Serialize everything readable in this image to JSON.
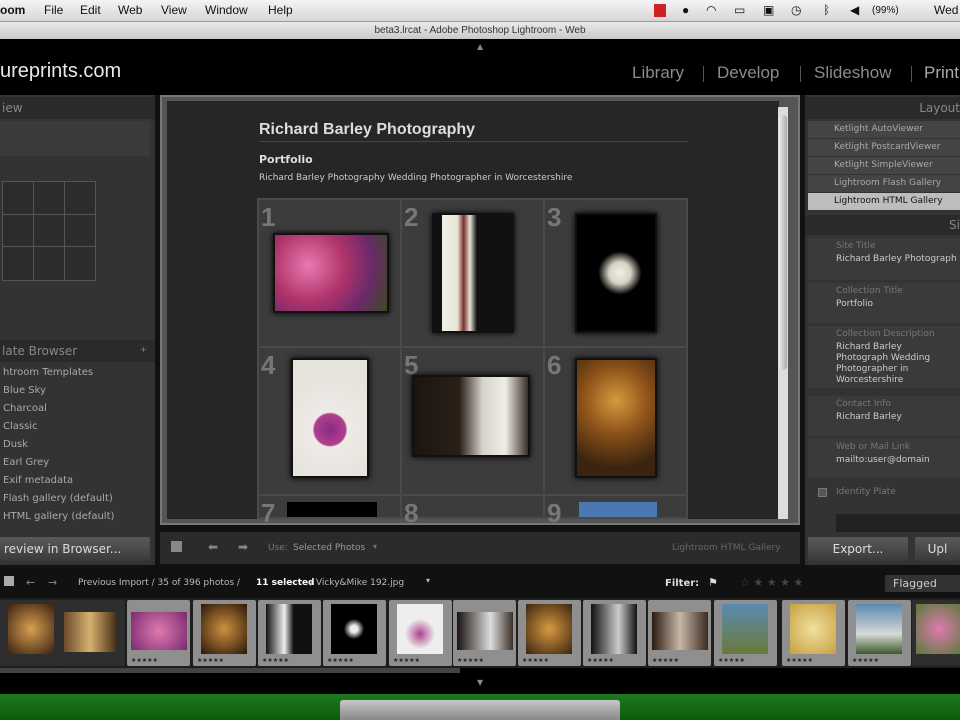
{
  "menubar": {
    "app": "oom",
    "items": [
      "File",
      "Edit",
      "Web",
      "View",
      "Window",
      "Help"
    ],
    "battery": "(99%)",
    "day": "Wed"
  },
  "window": {
    "title": "beta3.lrcat - Adobe Photoshop Lightroom - Web"
  },
  "header": {
    "logo": "ureprints.com",
    "modules": [
      "Library",
      "Develop",
      "Slideshow",
      "Print"
    ]
  },
  "left": {
    "preview_header": "iew",
    "template_header": "late Browser",
    "templates": [
      "htroom Templates",
      "Blue Sky",
      "Charcoal",
      "Classic",
      "Dusk",
      "Earl Grey",
      "Exif metadata",
      "Flash gallery (default)",
      "HTML gallery (default)"
    ],
    "preview_button": "review in Browser..."
  },
  "gallery": {
    "title": "Richard Barley Photography",
    "collection": "Portfolio",
    "description": "Richard Barley Photography Wedding Photographer in Worcestershire",
    "numbers": [
      "1",
      "2",
      "3",
      "4",
      "5",
      "6",
      "7",
      "8",
      "9"
    ]
  },
  "right": {
    "header": "Layout",
    "styles": [
      "Ketlight AutoViewer",
      "Ketlight PostcardViewer",
      "Ketlight SimpleViewer",
      "Lightroom Flash Gallery",
      "Lightroom HTML Gallery"
    ],
    "site_header": "Si",
    "fields": [
      {
        "label": "Site Title",
        "value": "Richard Barley Photograph"
      },
      {
        "label": "Collection Title",
        "value": "Portfolio"
      },
      {
        "label": "Collection Description",
        "value": "Richard Barley Photograph Wedding Photographer in Worcestershire"
      },
      {
        "label": "Contact Info",
        "value": "Richard Barley"
      },
      {
        "label": "Web or Mail Link",
        "value": "mailto:user@domain"
      }
    ],
    "identity_plate": "Identity Plate"
  },
  "toolbar": {
    "use": "Use:",
    "use_value": "Selected Photos",
    "engine": "Lightroom HTML Gallery",
    "export": "Export...",
    "upload": "Upl"
  },
  "filmbar": {
    "path": "Previous Import / 35 of 396 photos /",
    "selected": "11 selected",
    "file": "/ Vicky&Mike 192.jpg",
    "filter_label": "Filter:",
    "flag_value": "Flagged"
  },
  "colors": {
    "selected_thumb": "#8f8f8f",
    "panel": "#333333",
    "menubar": "#e6e6e6"
  }
}
